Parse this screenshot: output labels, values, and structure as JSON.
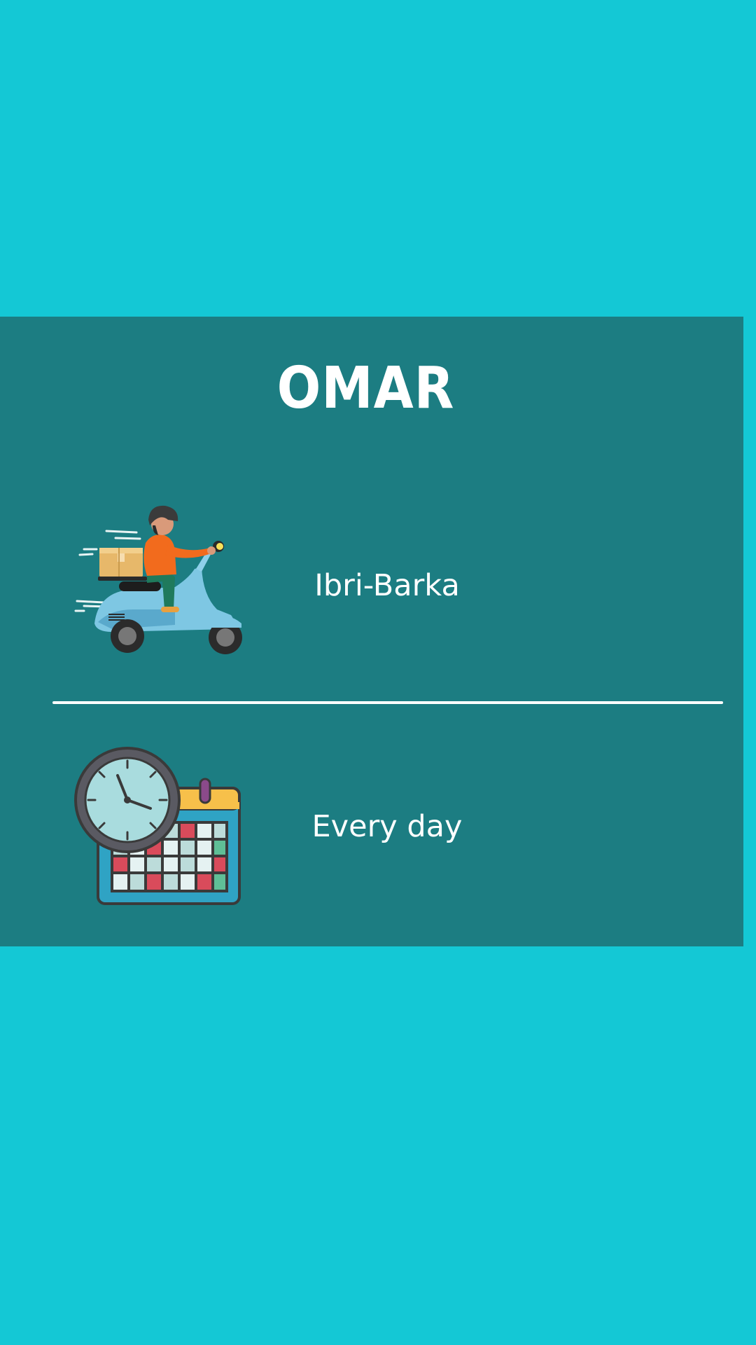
{
  "background_color": "#14c8d5",
  "card": {
    "background_color": "#1c7d82",
    "title": "OMAR",
    "rows": [
      {
        "icon": "delivery-scooter-icon",
        "text": "Ibri-Barka"
      },
      {
        "icon": "clock-calendar-icon",
        "text": "Every day"
      }
    ]
  }
}
